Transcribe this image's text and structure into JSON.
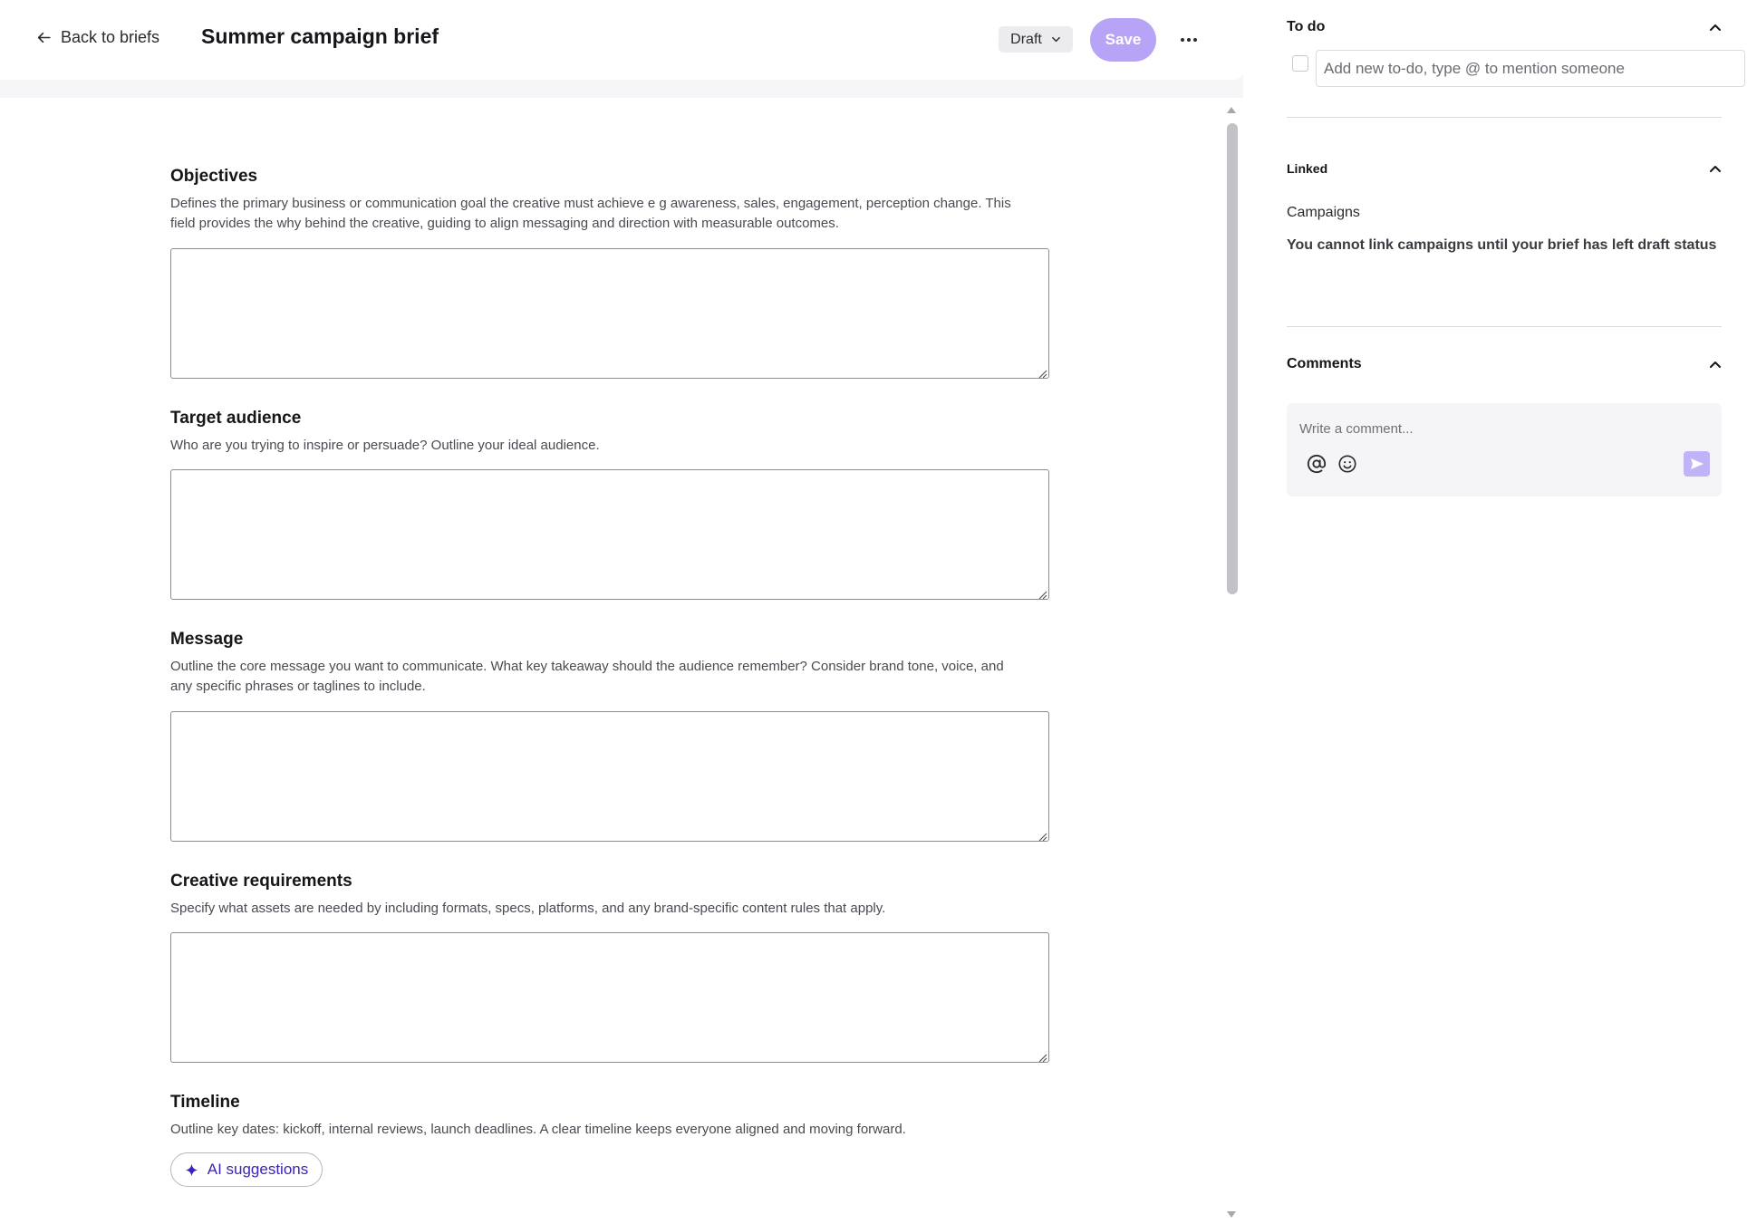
{
  "header": {
    "back_label": "Back to briefs",
    "title": "Summer campaign brief",
    "status": "Draft",
    "save_label": "Save"
  },
  "form": {
    "fields": [
      {
        "title": "Objectives",
        "description": "Defines the primary business or communication goal the creative must achieve e g awareness, sales, engagement, perception change. This field provides the why behind the creative, guiding to align messaging and direction with measurable outcomes.",
        "value": ""
      },
      {
        "title": "Target audience",
        "description": "Who are you trying to inspire or persuade? Outline your ideal audience.",
        "value": ""
      },
      {
        "title": "Message",
        "description": "Outline the core message you want to communicate. What key takeaway should the audience remember? Consider brand tone, voice, and any specific phrases or taglines to include.",
        "value": ""
      },
      {
        "title": "Creative requirements",
        "description": "Specify what assets are needed by including formats, specs, platforms, and any brand-specific content rules that apply.",
        "value": ""
      },
      {
        "title": "Timeline",
        "description": "Outline key dates: kickoff, internal reviews, launch deadlines. A clear timeline keeps everyone aligned and moving forward."
      }
    ],
    "ai_suggestions_label": "AI suggestions"
  },
  "sidebar": {
    "todo": {
      "title": "To do",
      "placeholder": "Add new to-do, type @ to mention someone",
      "value": ""
    },
    "linked": {
      "title": "Linked",
      "subtitle": "Campaigns",
      "note": "You cannot link campaigns until your brief has left draft status"
    },
    "comments": {
      "title": "Comments",
      "placeholder": "Write a comment...",
      "value": ""
    }
  },
  "colors": {
    "accent": "#b8a4f6",
    "accent_text": "#3d22b8",
    "background": "#f6f6f8"
  },
  "icons": {
    "back": "arrow-left-icon",
    "status": "chevron-down-icon",
    "more": "more-horizontal-icon",
    "ai": "sparkle-icon",
    "collapse": "chevron-up-icon",
    "mention": "at-sign-icon",
    "emoji": "smiley-icon",
    "send": "send-icon"
  }
}
